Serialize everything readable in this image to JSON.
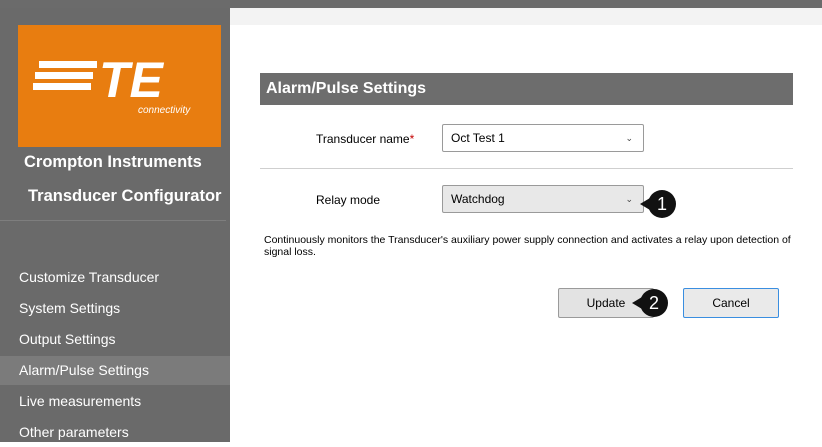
{
  "logo": {
    "mark_text": "TE",
    "subtitle": "connectivity"
  },
  "sidebar": {
    "brand_line1": "Crompton Instruments",
    "brand_line2": "Transducer Configurator",
    "items": [
      {
        "label": "Customize Transducer",
        "active": false
      },
      {
        "label": "System Settings",
        "active": false
      },
      {
        "label": "Output Settings",
        "active": false
      },
      {
        "label": "Alarm/Pulse Settings",
        "active": true
      },
      {
        "label": "Live measurements",
        "active": false
      },
      {
        "label": "Other parameters",
        "active": false
      }
    ]
  },
  "main": {
    "title": "Alarm/Pulse Settings",
    "transducer": {
      "label": "Transducer name",
      "required_mark": "*",
      "value": "Oct Test 1"
    },
    "relay": {
      "label": "Relay mode",
      "value": "Watchdog"
    },
    "description": "Continuously monitors the Transducer's auxiliary power supply connection and activates a relay upon detection of signal loss.",
    "buttons": {
      "update": "Update",
      "cancel": "Cancel"
    }
  },
  "callouts": {
    "one": "1",
    "two": "2"
  },
  "icons": {
    "select_chevron": "chevron-down-icon"
  },
  "colors": {
    "brand_orange": "#e87d10",
    "sidebar": "#6a6a6a",
    "header_bar": "#6d6d6d",
    "cancel_border": "#3a8ee0"
  }
}
